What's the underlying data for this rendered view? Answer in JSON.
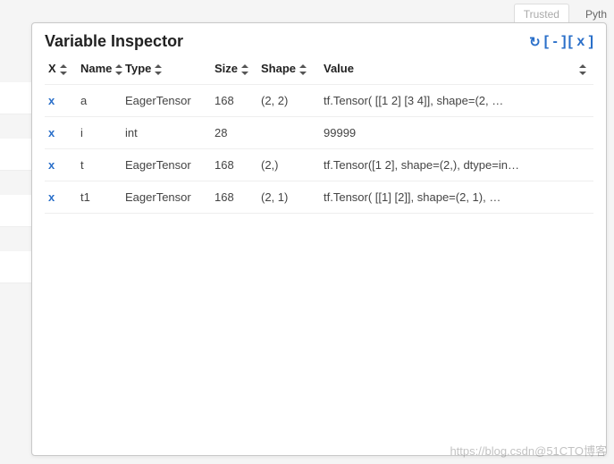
{
  "topbar": {
    "trusted": "Trusted",
    "kernel_fragment": "Pyth"
  },
  "panel": {
    "title": "Variable Inspector",
    "actions": {
      "refresh": "↻",
      "collapse": "[ - ]",
      "close": "[ x ]"
    }
  },
  "columns": {
    "x": "X",
    "name": "Name",
    "type": "Type",
    "size": "Size",
    "shape": "Shape",
    "value": "Value"
  },
  "rows": [
    {
      "del": "x",
      "name": "a",
      "type": "EagerTensor",
      "size": "168",
      "shape": "(2, 2)",
      "value": "tf.Tensor( [[1 2] [3 4]], shape=(2, …"
    },
    {
      "del": "x",
      "name": "i",
      "type": "int",
      "size": "28",
      "shape": "",
      "value": "99999"
    },
    {
      "del": "x",
      "name": "t",
      "type": "EagerTensor",
      "size": "168",
      "shape": "(2,)",
      "value": "tf.Tensor([1 2], shape=(2,), dtype=in…"
    },
    {
      "del": "x",
      "name": "t1",
      "type": "EagerTensor",
      "size": "168",
      "shape": "(2, 1)",
      "value": "tf.Tensor( [[1] [2]], shape=(2, 1), …"
    }
  ],
  "watermark": "https://blog.csdn@51CTO博客"
}
